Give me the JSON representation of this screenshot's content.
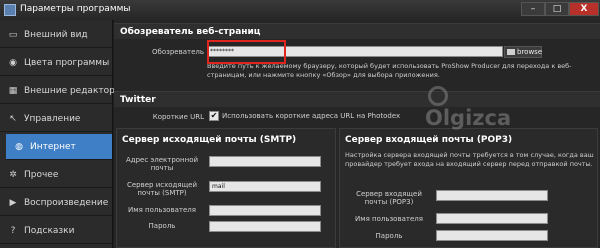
{
  "window": {
    "title": "Параметры программы",
    "min": "–",
    "max": "□",
    "close": "X"
  },
  "sidebar": {
    "items": [
      {
        "label": "Внешний вид",
        "icon": "monitor-icon"
      },
      {
        "label": "Цвета программы",
        "icon": "palette-icon"
      },
      {
        "label": "Внешние редакторы",
        "icon": "film-icon"
      },
      {
        "label": "Управление",
        "icon": "cursor-icon"
      },
      {
        "label": "Интернет",
        "icon": "globe-icon",
        "active": true
      },
      {
        "label": "Прочее",
        "icon": "gear-icon"
      },
      {
        "label": "Воспроизведение",
        "icon": "play-icon"
      },
      {
        "label": "Подсказки",
        "icon": "question-icon"
      }
    ]
  },
  "browser": {
    "header": "Обозреватель веб-страниц",
    "label": "Обозреватель",
    "value": "********",
    "browse_label": "browse",
    "hint": "Введите путь к желаемому браузеру, который будет использовать ProShow Producer для перехода к веб-страницам, или нажмите кнопку «Обзор» для выбора приложения."
  },
  "twitter": {
    "header": "Twitter",
    "label": "Короткие URL",
    "checkbox_text": "Использовать короткие адреса URL на Photodex",
    "checked": true
  },
  "smtp": {
    "title": "Сервер исходящей почты (SMTP)",
    "email_label": "Адрес электронной почты",
    "server_label": "Сервер исходящей почты (SMTP)",
    "server_value": "mail",
    "user_label": "Имя пользователя",
    "password_label": "Пароль"
  },
  "pop3": {
    "title": "Сервер входящей почты (POP3)",
    "desc": "Настройка сервера входящей почты требуется в том случае, когда ваш провайдер требует входа на входящий сервер перед отправкой почты.",
    "server_label": "Сервер входящей почты (POP3)",
    "user_label": "Имя пользователя",
    "password_label": "Пароль"
  },
  "watermark": "Olgizca",
  "colors": {
    "accent": "#3f7fc6",
    "highlight": "#e0241e"
  }
}
